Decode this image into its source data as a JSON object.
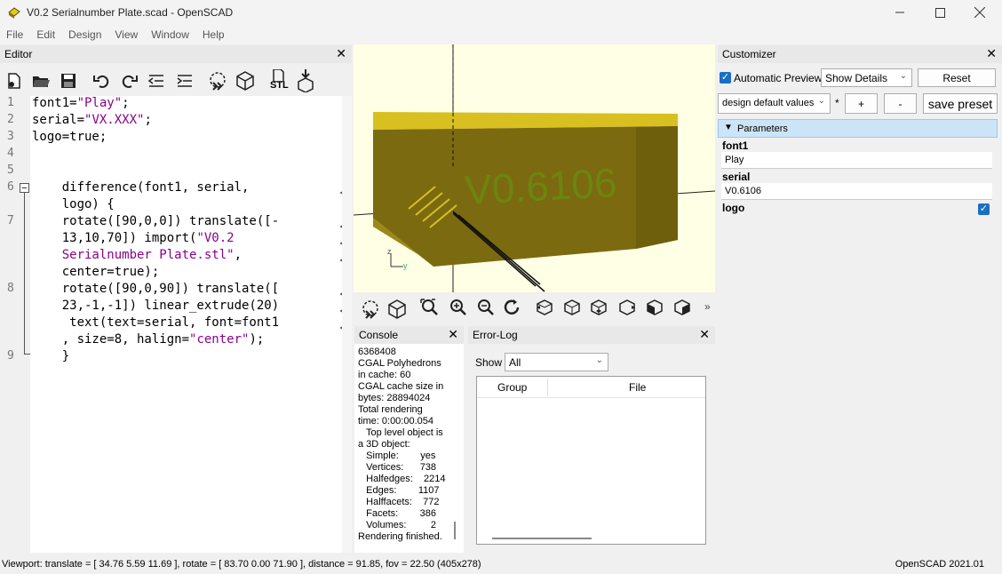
{
  "window": {
    "title": "V0.2 Serialnumber Plate.scad - OpenSCAD",
    "controls": [
      "minimize-icon",
      "maximize-icon",
      "close-icon"
    ]
  },
  "menu": [
    "File",
    "Edit",
    "Design",
    "View",
    "Window",
    "Help"
  ],
  "editor": {
    "title": "Editor",
    "close": "✕",
    "toolbar_icons": [
      "new-file-icon",
      "open-file-icon",
      "save-icon",
      "undo-icon",
      "redo-icon",
      "unindent-icon",
      "indent-icon",
      "preview-icon",
      "render-icon",
      "export-stl-icon",
      "send-to-print-icon"
    ],
    "stl_label": "STL",
    "line_numbers": [
      "1",
      "2",
      "3",
      "4",
      "5",
      "6",
      "7",
      "8",
      "9"
    ],
    "lines": [
      [
        "font1=",
        "\"Play\"",
        ";"
      ],
      [
        "serial=",
        "\"VX.XXX\"",
        ";"
      ],
      [
        "logo=true;"
      ],
      [
        ""
      ],
      [
        ""
      ],
      [
        "    difference(font1, serial,"
      ],
      [
        "    logo) {"
      ],
      [
        "    rotate([90,0,0]) translate([-"
      ],
      [
        "    13,10,70]) import(",
        "\"V0.2",
        ""
      ],
      [
        "    ",
        "Serialnumber Plate.stl\"",
        ","
      ],
      [
        "    center=true);"
      ],
      [
        "    rotate([90,0,90]) translate(["
      ],
      [
        "    23,-1,-1]) linear_extrude(20)"
      ],
      [
        "     text(text=serial, font=font1"
      ],
      [
        "    , size=8, halign=",
        "\"center\"",
        ");"
      ],
      [
        "    }"
      ]
    ]
  },
  "viewport": {
    "model_text": "V0.6106",
    "axis_labels": [
      "z",
      "y"
    ],
    "toolbar_icons": [
      "preview-icon",
      "render-icon",
      "view-all-icon",
      "zoom-in-icon",
      "zoom-out-icon",
      "reset-view-icon",
      "view-right-icon",
      "view-top-icon",
      "view-bottom-icon",
      "view-left-icon",
      "view-front-icon",
      "view-back-icon",
      "more-icon"
    ],
    "more": "»"
  },
  "console": {
    "title": "Console",
    "close": "✕",
    "lines": [
      "6368408",
      "CGAL Polyhedrons",
      "in cache: 60",
      "CGAL cache size in",
      "bytes: 28894024",
      "Total rendering",
      "time: 0:00:00.054",
      "   Top level object is",
      "a 3D object:",
      "   Simple:        yes",
      "   Vertices:      738",
      "   Halfedges:    2214",
      "   Edges:        1107",
      "   Halffacets:    772",
      "   Facets:        386",
      "   Volumes:         2",
      "Rendering finished."
    ]
  },
  "errorlog": {
    "title": "Error-Log",
    "close": "✕",
    "show_label": "Show",
    "show_value": "All",
    "columns": [
      "Group",
      "File"
    ]
  },
  "customizer": {
    "title": "Customizer",
    "close": "✕",
    "auto_preview_label": "Automatic Preview",
    "details_value": "Show Details",
    "reset_label": "Reset",
    "preset_value": "design default values",
    "asterisk": "*",
    "plus_label": "+",
    "minus_label": "-",
    "save_preset_label": "save preset",
    "parameters_label": "Parameters",
    "params": [
      {
        "name": "font1",
        "value": "Play"
      },
      {
        "name": "serial",
        "value": "V0.6106"
      },
      {
        "name": "logo",
        "value": "true"
      }
    ]
  },
  "statusbar": {
    "left": "Viewport: translate = [ 34.76 5.59 11.69 ], rotate = [ 83.70 0.00 71.90 ], distance = 91.85, fov = 22.50 (405x278)",
    "right": "OpenSCAD 2021.01"
  },
  "colors": {
    "model_top": "#d8c020",
    "model_side": "#7b6a10",
    "viewport_bg": "#ffffe5",
    "keyword": "#8b008b",
    "accent": "#1a6fc2"
  }
}
